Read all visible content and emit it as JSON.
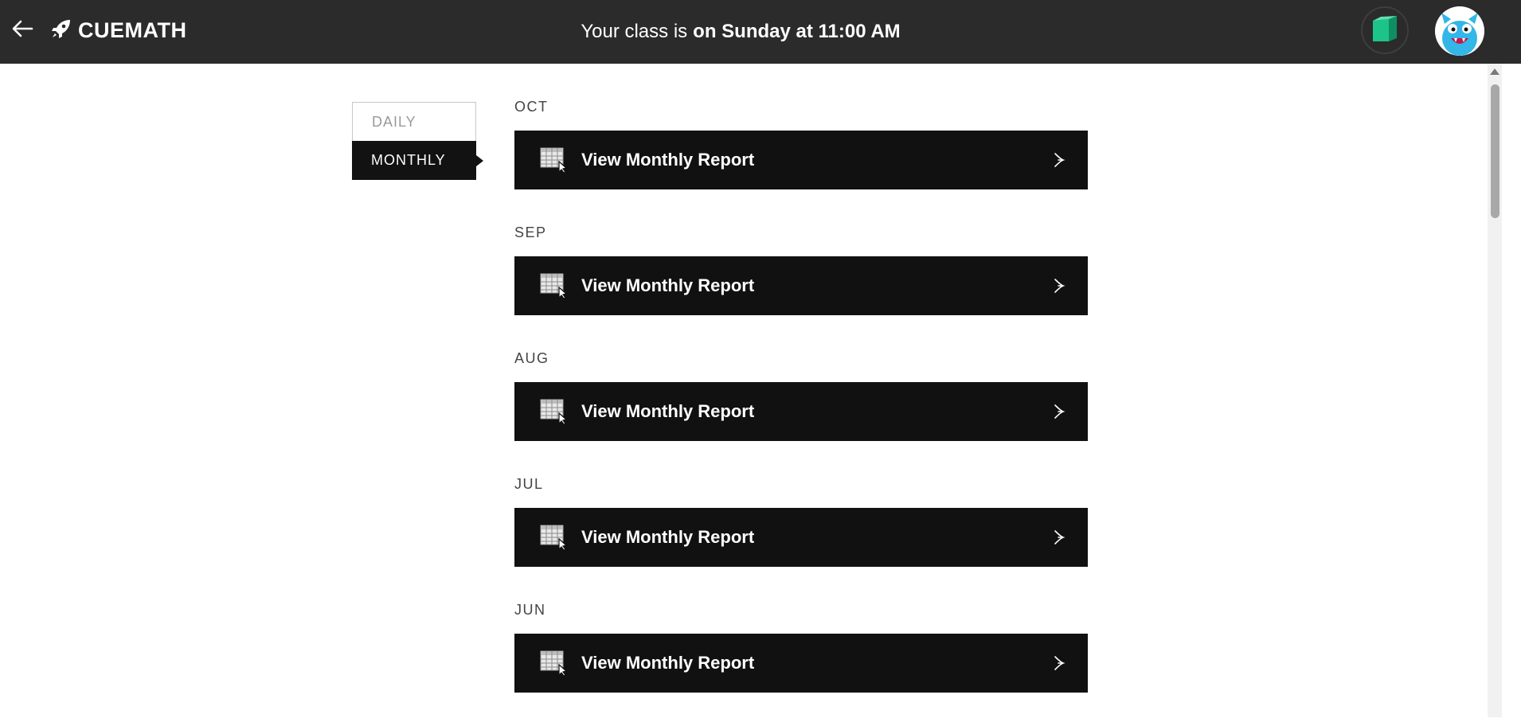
{
  "header": {
    "brand_name": "CUEMATH",
    "class_lead": "Your class is",
    "class_when": "on Sunday at 11:00 AM",
    "icons": [
      "back-arrow-icon",
      "rocket-icon",
      "green-cube-icon",
      "monster-avatar"
    ]
  },
  "tabs": [
    {
      "label": "DAILY",
      "active": false
    },
    {
      "label": "MONTHLY",
      "active": true
    }
  ],
  "reports": [
    {
      "month": "OCT",
      "label": "View Monthly Report"
    },
    {
      "month": "SEP",
      "label": "View Monthly Report"
    },
    {
      "month": "AUG",
      "label": "View Monthly Report"
    },
    {
      "month": "JUL",
      "label": "View Monthly Report"
    },
    {
      "month": "JUN",
      "label": "View Monthly Report"
    }
  ],
  "colors": {
    "topbar": "#2b2b2b",
    "row_bg": "#111111",
    "cube_green": "#1cc48a",
    "avatar_blue": "#33b6e8"
  }
}
